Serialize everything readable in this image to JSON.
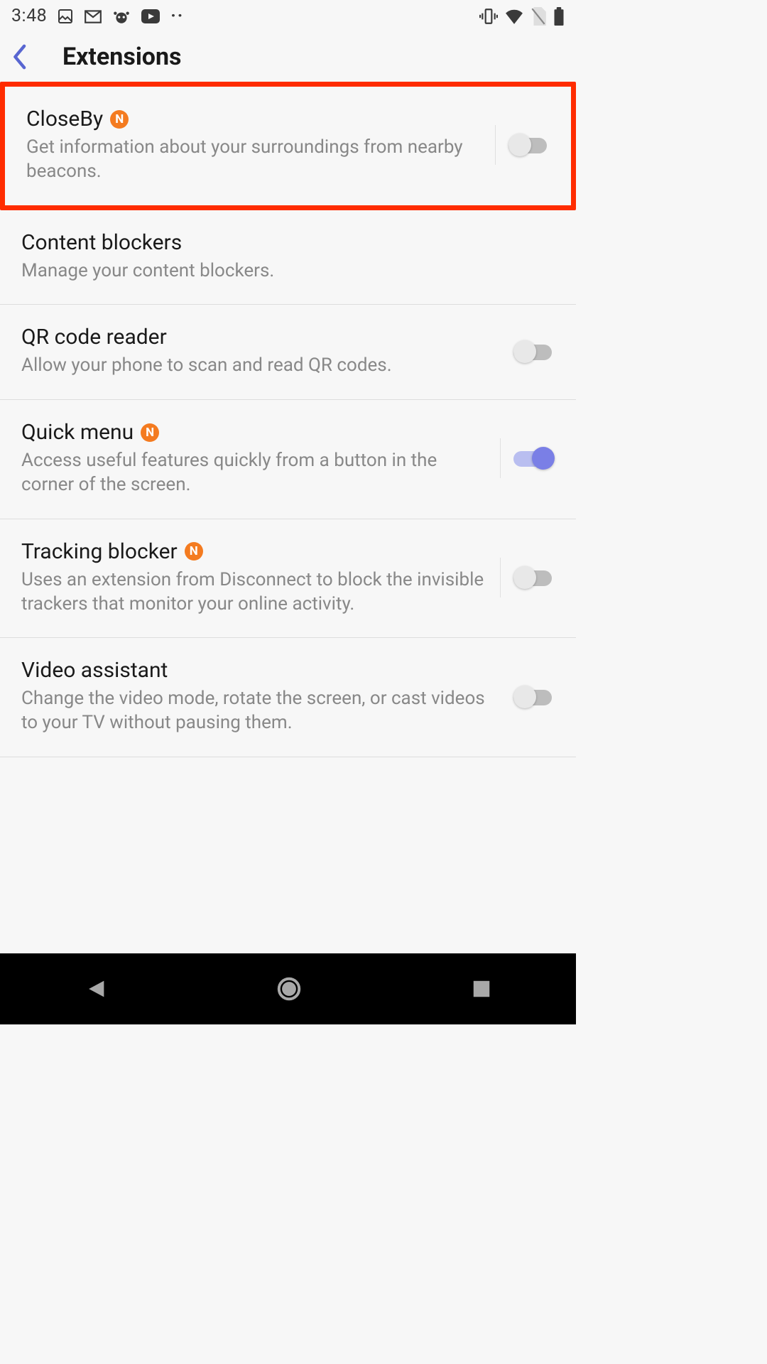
{
  "status": {
    "time": "3:48",
    "app_icons": [
      "photos",
      "gmail",
      "reddit",
      "youtube"
    ],
    "more_dots": "··",
    "system_icons": [
      "vibrate",
      "wifi",
      "no-sim",
      "battery"
    ]
  },
  "header": {
    "title": "Extensions"
  },
  "items": {
    "closeby": {
      "title": "CloseBy",
      "desc": "Get information about your surroundings from nearby beacons.",
      "badge": "N",
      "enabled": false,
      "highlighted": true
    },
    "content_blockers": {
      "title": "Content blockers",
      "desc": "Manage your content blockers.",
      "has_toggle": false
    },
    "qr": {
      "title": "QR code reader",
      "desc": "Allow your phone to scan and read QR codes.",
      "enabled": false
    },
    "quick_menu": {
      "title": "Quick menu",
      "desc": "Access useful features quickly from a button in the corner of the screen.",
      "badge": "N",
      "enabled": true
    },
    "tracking": {
      "title": "Tracking blocker",
      "desc": "Uses an extension from Disconnect to block the invisible trackers that monitor your online activity.",
      "badge": "N",
      "enabled": false
    },
    "video": {
      "title": "Video assistant",
      "desc": "Change the video mode, rotate the screen, or cast videos to your TV without pausing them.",
      "enabled": false
    }
  }
}
